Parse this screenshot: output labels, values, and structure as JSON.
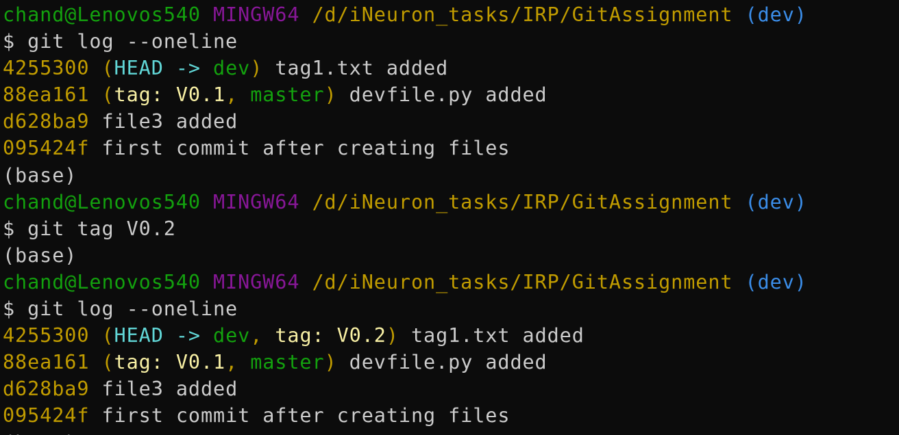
{
  "colors": {
    "background": "#0c0c0c",
    "text": "#cccccc",
    "user_host": "#13a10e",
    "mingw": "#881798",
    "path": "#c19c00",
    "branch_paren": "#3b78ff",
    "hash": "#c19c00",
    "head": "#3a96dd",
    "local_branch": "#13a10e",
    "tag": "#f9f1a5"
  },
  "lines": [
    {
      "segments": [
        {
          "text": "chand@Lenovos540",
          "color": "#13a10e"
        },
        {
          "text": " ",
          "color": "#cccccc"
        },
        {
          "text": "MINGW64",
          "color": "#881798"
        },
        {
          "text": " ",
          "color": "#cccccc"
        },
        {
          "text": "/d/iNeuron_tasks/IRP/GitAssignment",
          "color": "#c19c00"
        },
        {
          "text": " ",
          "color": "#cccccc"
        },
        {
          "text": "(dev)",
          "color": "#3b8eea"
        }
      ]
    },
    {
      "segments": [
        {
          "text": "$ git log --oneline",
          "color": "#cccccc"
        }
      ]
    },
    {
      "segments": [
        {
          "text": "4255300",
          "color": "#c19c00"
        },
        {
          "text": " ",
          "color": "#cccccc"
        },
        {
          "text": "(",
          "color": "#c19c00"
        },
        {
          "text": "HEAD -> ",
          "color": "#61d6d6"
        },
        {
          "text": "dev",
          "color": "#13a10e"
        },
        {
          "text": ")",
          "color": "#c19c00"
        },
        {
          "text": " tag1.txt added",
          "color": "#cccccc"
        }
      ]
    },
    {
      "segments": [
        {
          "text": "88ea161",
          "color": "#c19c00"
        },
        {
          "text": " ",
          "color": "#cccccc"
        },
        {
          "text": "(",
          "color": "#c19c00"
        },
        {
          "text": "tag: V0.1",
          "color": "#f9f1a5"
        },
        {
          "text": ", ",
          "color": "#c19c00"
        },
        {
          "text": "master",
          "color": "#13a10e"
        },
        {
          "text": ")",
          "color": "#c19c00"
        },
        {
          "text": " devfile.py added",
          "color": "#cccccc"
        }
      ]
    },
    {
      "segments": [
        {
          "text": "d628ba9",
          "color": "#c19c00"
        },
        {
          "text": " file3 added",
          "color": "#cccccc"
        }
      ]
    },
    {
      "segments": [
        {
          "text": "095424f",
          "color": "#c19c00"
        },
        {
          "text": " first commit after creating files",
          "color": "#cccccc"
        }
      ]
    },
    {
      "segments": [
        {
          "text": "(base)",
          "color": "#cccccc"
        }
      ]
    },
    {
      "segments": [
        {
          "text": "chand@Lenovos540",
          "color": "#13a10e"
        },
        {
          "text": " ",
          "color": "#cccccc"
        },
        {
          "text": "MINGW64",
          "color": "#881798"
        },
        {
          "text": " ",
          "color": "#cccccc"
        },
        {
          "text": "/d/iNeuron_tasks/IRP/GitAssignment",
          "color": "#c19c00"
        },
        {
          "text": " ",
          "color": "#cccccc"
        },
        {
          "text": "(dev)",
          "color": "#3b8eea"
        }
      ]
    },
    {
      "segments": [
        {
          "text": "$ git tag V0.2",
          "color": "#cccccc"
        }
      ]
    },
    {
      "segments": [
        {
          "text": "(base)",
          "color": "#cccccc"
        }
      ]
    },
    {
      "segments": [
        {
          "text": "chand@Lenovos540",
          "color": "#13a10e"
        },
        {
          "text": " ",
          "color": "#cccccc"
        },
        {
          "text": "MINGW64",
          "color": "#881798"
        },
        {
          "text": " ",
          "color": "#cccccc"
        },
        {
          "text": "/d/iNeuron_tasks/IRP/GitAssignment",
          "color": "#c19c00"
        },
        {
          "text": " ",
          "color": "#cccccc"
        },
        {
          "text": "(dev)",
          "color": "#3b8eea"
        }
      ]
    },
    {
      "segments": [
        {
          "text": "$ git log --oneline",
          "color": "#cccccc"
        }
      ]
    },
    {
      "segments": [
        {
          "text": "4255300",
          "color": "#c19c00"
        },
        {
          "text": " ",
          "color": "#cccccc"
        },
        {
          "text": "(",
          "color": "#c19c00"
        },
        {
          "text": "HEAD -> ",
          "color": "#61d6d6"
        },
        {
          "text": "dev",
          "color": "#13a10e"
        },
        {
          "text": ", ",
          "color": "#c19c00"
        },
        {
          "text": "tag: V0.2",
          "color": "#f9f1a5"
        },
        {
          "text": ")",
          "color": "#c19c00"
        },
        {
          "text": " tag1.txt added",
          "color": "#cccccc"
        }
      ]
    },
    {
      "segments": [
        {
          "text": "88ea161",
          "color": "#c19c00"
        },
        {
          "text": " ",
          "color": "#cccccc"
        },
        {
          "text": "(",
          "color": "#c19c00"
        },
        {
          "text": "tag: V0.1",
          "color": "#f9f1a5"
        },
        {
          "text": ", ",
          "color": "#c19c00"
        },
        {
          "text": "master",
          "color": "#13a10e"
        },
        {
          "text": ")",
          "color": "#c19c00"
        },
        {
          "text": " devfile.py added",
          "color": "#cccccc"
        }
      ]
    },
    {
      "segments": [
        {
          "text": "d628ba9",
          "color": "#c19c00"
        },
        {
          "text": " file3 added",
          "color": "#cccccc"
        }
      ]
    },
    {
      "segments": [
        {
          "text": "095424f",
          "color": "#c19c00"
        },
        {
          "text": " first commit after creating files",
          "color": "#cccccc"
        }
      ]
    },
    {
      "segments": [
        {
          "text": "(base)",
          "color": "#cccccc"
        }
      ]
    }
  ]
}
